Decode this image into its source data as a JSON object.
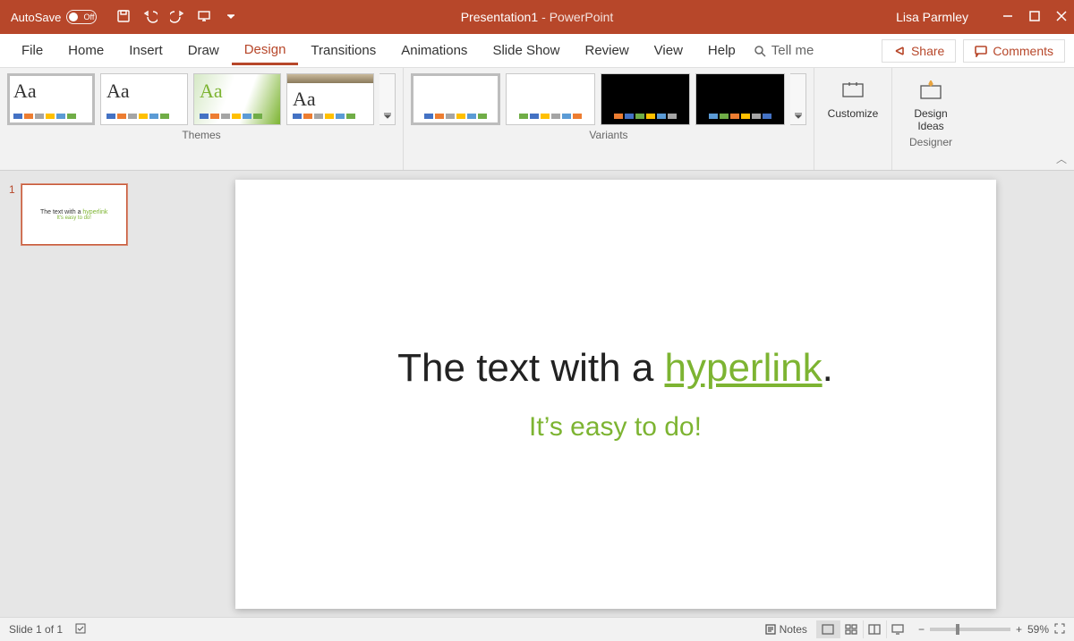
{
  "titlebar": {
    "autosave_label": "AutoSave",
    "autosave_state": "Off",
    "doc_name": "Presentation1",
    "app_name": "PowerPoint",
    "user": "Lisa Parmley"
  },
  "tabs": {
    "items": [
      "File",
      "Home",
      "Insert",
      "Draw",
      "Design",
      "Transitions",
      "Animations",
      "Slide Show",
      "Review",
      "View",
      "Help"
    ],
    "active": "Design",
    "tell_me": "Tell me",
    "share": "Share",
    "comments": "Comments"
  },
  "ribbon": {
    "themes_label": "Themes",
    "variants_label": "Variants",
    "customize_label": "Customize",
    "design_ideas_label": "Design Ideas",
    "designer_label": "Designer",
    "theme_swatch_colors": [
      "#4472c4",
      "#ed7d31",
      "#a5a5a5",
      "#ffc000",
      "#5b9bd5",
      "#70ad47"
    ],
    "variant_sets": [
      [
        "#4472c4",
        "#ed7d31",
        "#a5a5a5",
        "#ffc000",
        "#5b9bd5",
        "#70ad47"
      ],
      [
        "#70ad47",
        "#4472c4",
        "#ffc000",
        "#a5a5a5",
        "#5b9bd5",
        "#ed7d31"
      ],
      [
        "#ed7d31",
        "#4472c4",
        "#70ad47",
        "#ffc000",
        "#5b9bd5",
        "#a5a5a5"
      ],
      [
        "#5b9bd5",
        "#70ad47",
        "#ed7d31",
        "#ffc000",
        "#a5a5a5",
        "#4472c4"
      ]
    ]
  },
  "thumbnails": {
    "slide_number": "1",
    "mini_title_prefix": "The text with a ",
    "mini_title_link": "hyperlink",
    "mini_sub": "It's easy to do!"
  },
  "slide": {
    "title_prefix": "The text with a ",
    "title_link": "hyperlink",
    "title_suffix": ".",
    "subtitle": "It’s easy to do!"
  },
  "status": {
    "slide_counter": "Slide 1 of 1",
    "notes_label": "Notes",
    "zoom_pct": "59%"
  }
}
